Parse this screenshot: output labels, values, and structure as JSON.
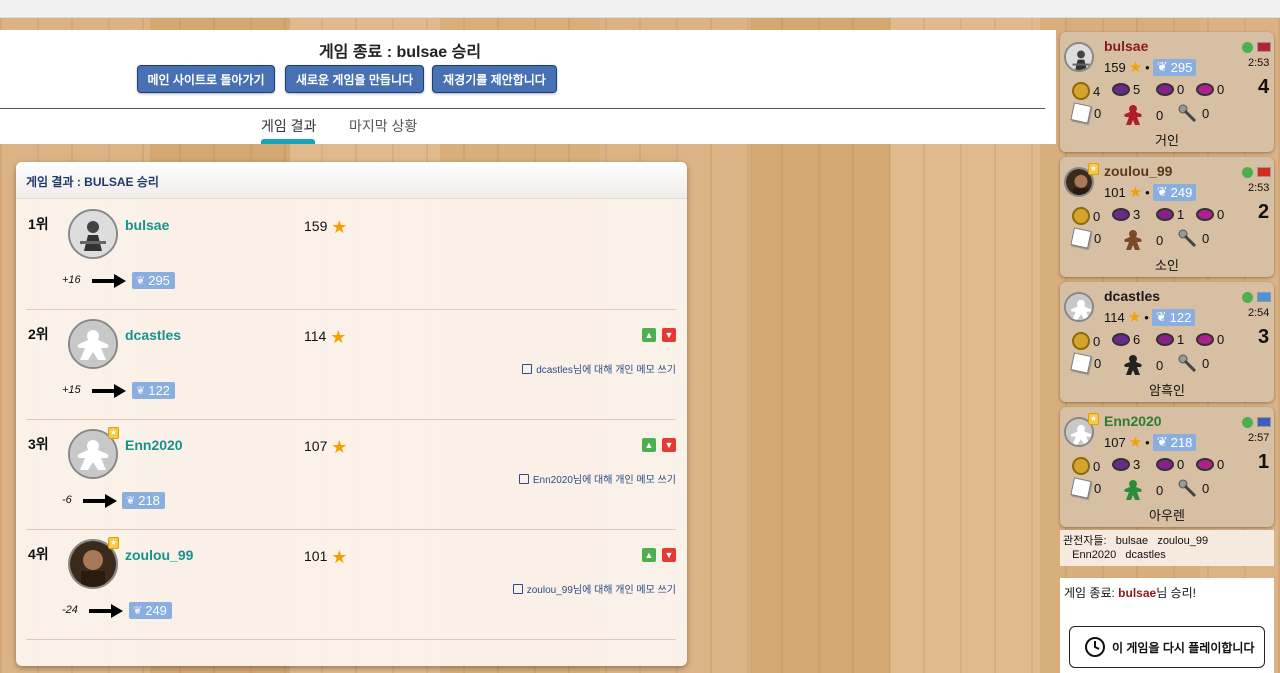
{
  "header": {
    "end_title": "게임 종료 : bulsae 승리",
    "buttons": {
      "main_site": "메인 사이트로 돌아가기",
      "new_game": "새로운 게임을 만듭니다",
      "rematch": "재경기를 제안합니다"
    },
    "tabs": {
      "results": "게임 결과",
      "last_state": "마지막 상황"
    }
  },
  "results": {
    "title": "게임 결과 : BULSAE 승리",
    "rows": [
      {
        "rank": "1위",
        "name": "bulsae",
        "score": "159",
        "delta": "+16",
        "elo": "295",
        "memo": ""
      },
      {
        "rank": "2위",
        "name": "dcastles",
        "score": "114",
        "delta": "+15",
        "elo": "122",
        "memo": "dcastles님에 대해 개인 메모 쓰기"
      },
      {
        "rank": "3위",
        "name": "Enn2020",
        "score": "107",
        "delta": "-6",
        "elo": "218",
        "memo": "Enn2020님에 대해 개인 메모 쓰기"
      },
      {
        "rank": "4위",
        "name": "zoulou_99",
        "score": "101",
        "delta": "-24",
        "elo": "249",
        "memo": "zoulou_99님에 대해 개인 메모 쓰기"
      }
    ]
  },
  "players": [
    {
      "name": "bulsae",
      "color": "#8b1a1a",
      "score": "159",
      "elo": "295",
      "time": "2:53",
      "order": "4",
      "coins": "4",
      "g1": "5",
      "g2": "0",
      "g3": "0",
      "cubes": "0",
      "meeples": "0",
      "shovels": "0",
      "meeple_color": "#b01e2e",
      "role": "거인"
    },
    {
      "name": "zoulou_99",
      "color": "#5a3a1a",
      "score": "101",
      "elo": "249",
      "time": "2:53",
      "order": "2",
      "coins": "0",
      "g1": "3",
      "g2": "1",
      "g3": "0",
      "cubes": "0",
      "meeples": "0",
      "shovels": "0",
      "meeple_color": "#7b4a28",
      "role": "소인"
    },
    {
      "name": "dcastles",
      "color": "#1a1a1a",
      "score": "114",
      "elo": "122",
      "time": "2:54",
      "order": "3",
      "coins": "0",
      "g1": "6",
      "g2": "1",
      "g3": "0",
      "cubes": "0",
      "meeples": "0",
      "shovels": "0",
      "meeple_color": "#222222",
      "role": "암흑인"
    },
    {
      "name": "Enn2020",
      "color": "#2e7d32",
      "score": "107",
      "elo": "218",
      "time": "2:57",
      "order": "1",
      "coins": "0",
      "g1": "3",
      "g2": "0",
      "g3": "0",
      "cubes": "0",
      "meeples": "0",
      "shovels": "0",
      "meeple_color": "#2e8b3a",
      "role": "아우렌"
    }
  ],
  "spectators": {
    "label": "관전자들:",
    "names": [
      "bulsae",
      "zoulou_99",
      "Enn2020",
      "dcastles"
    ]
  },
  "final_message": {
    "prefix": "게임 종료: ",
    "winner": "bulsae",
    "suffix": "님 승리!"
  },
  "replay_label": "이 게임을 다시 플레이합니다"
}
